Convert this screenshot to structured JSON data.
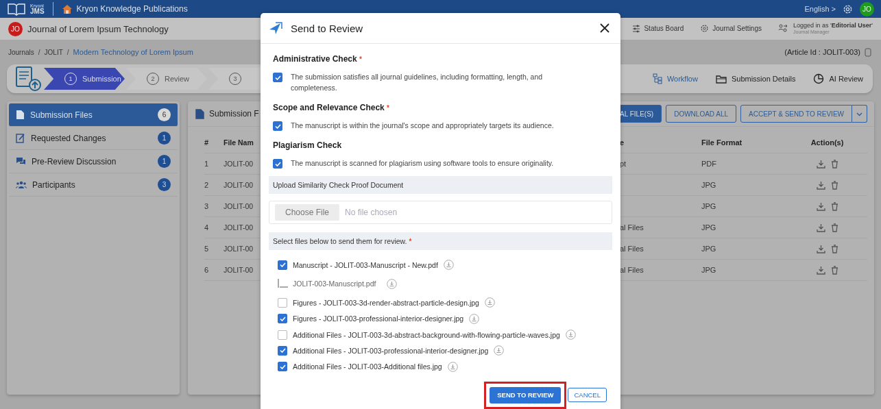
{
  "topbar": {
    "logo_small": "Kryoni",
    "logo_big": "JMS",
    "publisher": "Kryon Knowledge Publications",
    "language": "English >",
    "avatar": "JO"
  },
  "subheader": {
    "avatar": "JO",
    "journal": "Journal of Lorem Ipsum Technology",
    "links": [
      "Status Board",
      "Journal Settings"
    ],
    "login": "Logged in as '**Editorial User**'",
    "role": "Journal Manager"
  },
  "breadcrumb": {
    "separator": "/",
    "items": [
      "Journals",
      "JOLIT"
    ],
    "current": "Modern Technology of Lorem Ipsum",
    "article_id": "(Article Id : JOLIT-003)"
  },
  "steps": [
    {
      "num": "1",
      "label": "Submission",
      "selected": true
    },
    {
      "num": "2",
      "label": "Review",
      "selected": false
    },
    {
      "num": "3",
      "selected": false
    }
  ],
  "step_links": [
    {
      "label": "Workflow",
      "selected": true
    },
    {
      "label": "Submission Details",
      "selected": false
    },
    {
      "label": "AI Review",
      "selected": false
    }
  ],
  "sidebar": {
    "items": [
      {
        "label": "Submission Files",
        "count": "6",
        "selected": true
      },
      {
        "label": "Requested Changes",
        "count": "1",
        "selected": false
      },
      {
        "label": "Pre-Review Discussion",
        "count": "1",
        "selected": false
      },
      {
        "label": "Participants",
        "count": "3",
        "selected": false
      }
    ]
  },
  "panel": {
    "title": "Submission F",
    "buttons": [
      {
        "label": "AL FILE(S)",
        "kind": "primary"
      },
      {
        "label": "DOWNLOAD ALL",
        "kind": "outline"
      },
      {
        "label": "ACCEPT & SEND TO REVIEW",
        "kind": "split"
      }
    ]
  },
  "table": {
    "columns": [
      "#",
      "File Nam",
      "e",
      "File Format",
      "Action(s)"
    ],
    "rows": [
      {
        "num": "1",
        "file": "JOLIT-00",
        "column_3": "pt",
        "format": "PDF"
      },
      {
        "num": "2",
        "file": "JOLIT-00",
        "format": "JPG"
      },
      {
        "num": "3",
        "file": "JOLIT-00",
        "format": "JPG"
      },
      {
        "num": "4",
        "file": "JOLIT-00",
        "column_3": "al Files",
        "format": "JPG"
      },
      {
        "num": "5",
        "file": "JOLIT-00",
        "column_3": "al Files",
        "format": "JPG"
      },
      {
        "num": "6",
        "file": "JOLIT-00",
        "column_3": "al Files",
        "format": "JPG"
      }
    ]
  },
  "modal": {
    "title": "Send to Review",
    "required_mark": "*",
    "checks": [
      {
        "title": "Administrative Check",
        "required": true,
        "text": "The submission satisfies all journal guidelines, including formatting, length, and completeness.",
        "checked": true
      },
      {
        "title": "Scope and Relevance Check",
        "required": true,
        "text": "The manuscript is within the journal's scope and appropriately targets its audience.",
        "checked": true
      },
      {
        "title": "Plagiarism Check",
        "required": false,
        "text": "The manuscript is scanned for plagiarism using software tools to ensure originality.",
        "checked": true
      }
    ],
    "upload": {
      "label": "Upload Similarity Check Proof Document",
      "button": "Choose File",
      "status": "No file chosen"
    },
    "files_label": "Select files below to send them for review.",
    "files_required": true,
    "files": [
      {
        "label": "Manuscript - JOLIT-003-Manuscript - New.pdf",
        "checked": true,
        "children": [
          {
            "label": "JOLIT-003-Manuscript.pdf"
          }
        ]
      },
      {
        "label": "Figures - JOLIT-003-3d-render-abstract-particle-design.jpg",
        "checked": false
      },
      {
        "label": "Figures - JOLIT-003-professional-interior-designer.jpg",
        "checked": true
      },
      {
        "label": "Additional Files - JOLIT-003-3d-abstract-background-with-flowing-particle-waves.jpg",
        "checked": false
      },
      {
        "label": "Additional Files - JOLIT-003-professional-interior-designer.jpg",
        "checked": true
      },
      {
        "label": "Additional Files - JOLIT-003-Additional files.jpg",
        "checked": true
      }
    ],
    "send": "SEND TO REVIEW",
    "send_highlighted": true,
    "cancel": "CANCEL"
  }
}
